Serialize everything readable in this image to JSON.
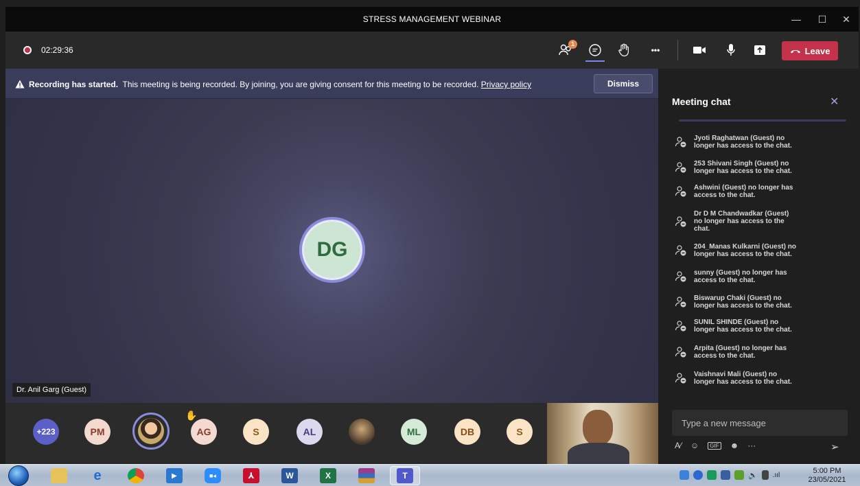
{
  "window": {
    "title": "STRESS MANAGEMENT WEBINAR",
    "minimize": "—",
    "maximize": "☐",
    "close": "✕"
  },
  "controls": {
    "recording_time": "02:29:36",
    "participants_badge": "1",
    "leave_label": "Leave",
    "more_label": "•••"
  },
  "banner": {
    "heading": "Recording has started.",
    "message": "This meeting is being recorded. By joining, you are giving consent for this meeting to be recorded.",
    "link": "Privacy policy",
    "dismiss": "Dismiss"
  },
  "stage": {
    "speaker_initials": "DG",
    "speaker_name": "Dr. Anil Garg (Guest)"
  },
  "gallery": {
    "overflow_count": "+223",
    "participants": [
      {
        "initials": "PM",
        "bg": "#f4d9d0",
        "fg": "#8a3a2a"
      },
      {
        "initials": "AG",
        "bg": "#f4d9d0",
        "fg": "#8a3a2a"
      },
      {
        "initials": "S",
        "bg": "#fbe3c6",
        "fg": "#8a5a1a"
      },
      {
        "initials": "AL",
        "bg": "#dcd8ee",
        "fg": "#4a3a7a"
      },
      {
        "initials": "ML",
        "bg": "#d6ead8",
        "fg": "#2e6b3e"
      },
      {
        "initials": "DB",
        "bg": "#fbe3c6",
        "fg": "#8a4a1a"
      },
      {
        "initials": "S",
        "bg": "#fbe3c6",
        "fg": "#8a5a1a"
      }
    ]
  },
  "chat": {
    "title": "Meeting chat",
    "messages": [
      [
        "Jyoti Raghatwan (Guest) no",
        "longer has access to the chat."
      ],
      [
        "253 Shivani Singh (Guest) no",
        "longer has access to the chat."
      ],
      [
        "Ashwini (Guest) no longer has",
        "access to the chat."
      ],
      [
        "Dr D M Chandwadkar (Guest)",
        "no longer has access to the",
        "chat."
      ],
      [
        "204_Manas Kulkarni (Guest) no",
        "longer has access to the chat."
      ],
      [
        "sunny (Guest) no longer has",
        "access to the chat."
      ],
      [
        "Biswarup Chaki (Guest) no",
        "longer has access to the chat."
      ],
      [
        "SUNIL SHINDE (Guest) no",
        "longer has access to the chat."
      ],
      [
        "Arpita (Guest) no longer has",
        "access to the chat."
      ],
      [
        "Vaishnavi Mali (Guest) no",
        "longer has access to the chat."
      ]
    ],
    "compose_placeholder": "Type a new message",
    "gif_label": "GIF",
    "more_label": "···"
  },
  "taskbar": {
    "time": "5:00 PM",
    "date": "23/05/2021"
  },
  "colors": {
    "accent": "#7f85f5",
    "leave": "#c4314b",
    "banner": "#3a3c5c"
  }
}
